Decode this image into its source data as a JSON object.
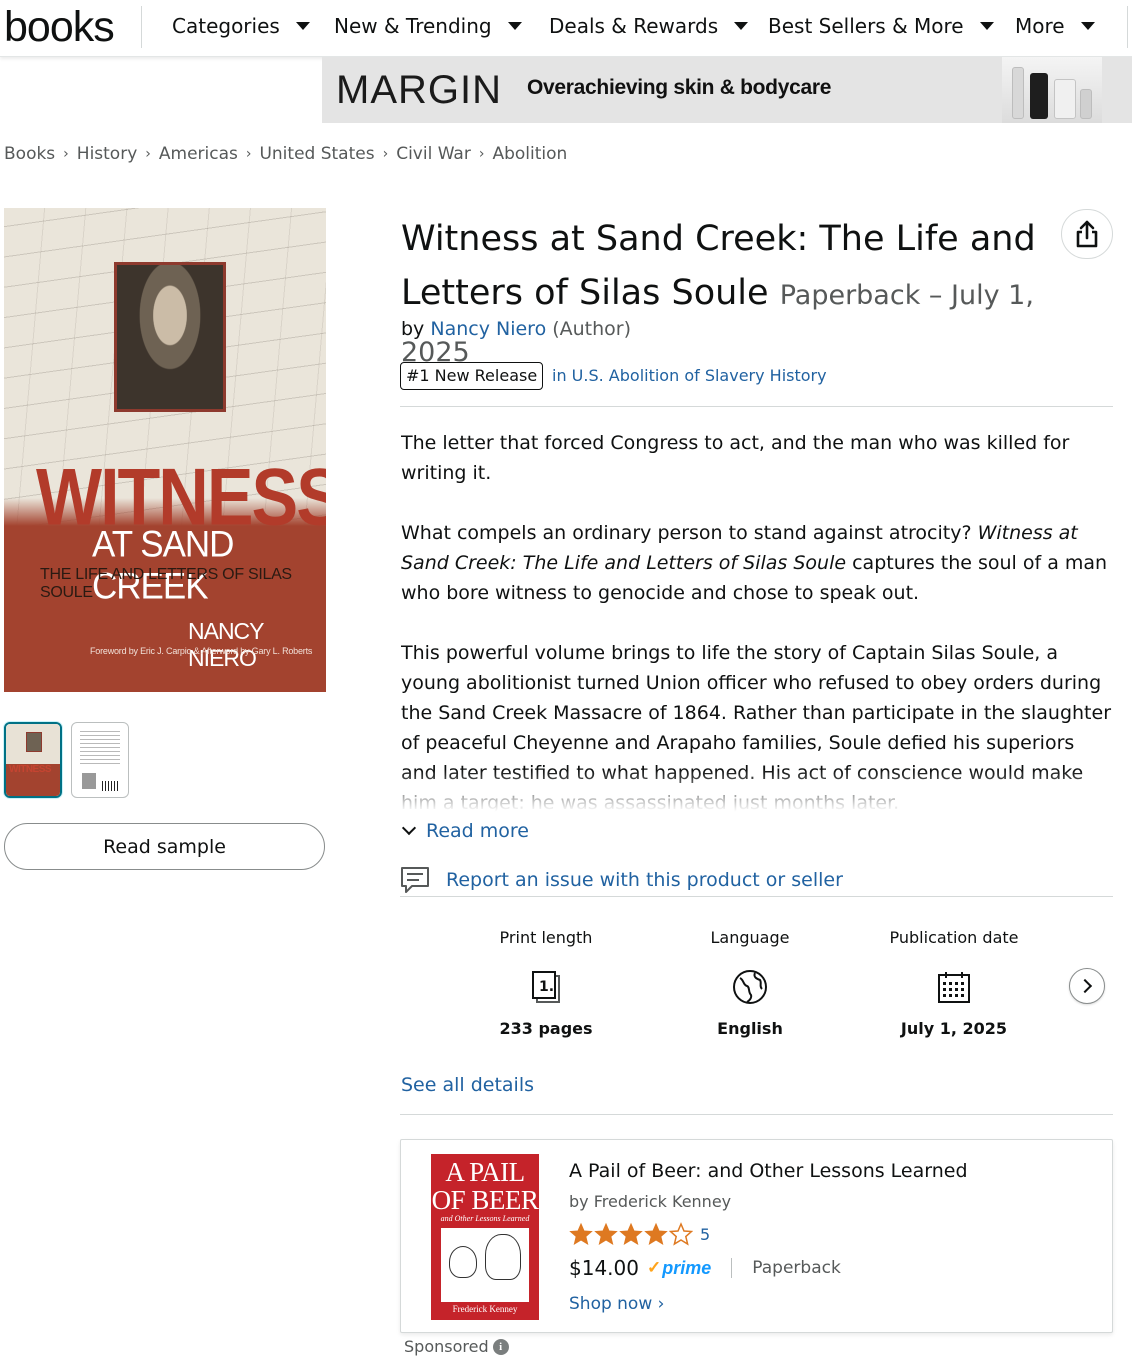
{
  "nav": {
    "logo": "books",
    "items": [
      "Categories",
      "New & Trending",
      "Deals & Rewards",
      "Best Sellers & More",
      "More"
    ]
  },
  "banner": {
    "brand": "MARGIN",
    "tagline": "Overachieving skin & bodycare"
  },
  "breadcrumb": [
    "Books",
    "History",
    "Americas",
    "United States",
    "Civil War",
    "Abolition"
  ],
  "cover": {
    "title": "WITNESS",
    "subtitle": "AT SAND CREEK",
    "subtitle2": "THE LIFE AND LETTERS OF SILAS SOULE",
    "author": "NANCY NIERO",
    "foreword": "Foreword by Eric J. Carpio & Afterword by Gary L. Roberts",
    "thumb_text": "WITNESS"
  },
  "read_sample": "Read sample",
  "product": {
    "title": "Witness at Sand Creek: The Life and Letters of Silas Soule",
    "format": "Paperback – July 1, 2025",
    "by": "by",
    "author": "Nancy Niero",
    "role": "(Author)",
    "badge": "#1 New Release",
    "badge_category": "in U.S. Abolition of Slavery History"
  },
  "description": {
    "p1": "The letter that forced Congress to act, and the man who was killed for writing it.",
    "p2_pre": "What compels an ordinary person to stand against atrocity? ",
    "p2_italic": "Witness at Sand Creek: The Life and Letters of Silas Soule",
    "p2_post": " captures the soul of a man who bore witness to genocide and chose to speak out.",
    "p3": "This powerful volume brings to life the story of Captain Silas Soule, a young abolitionist turned Union officer who refused to obey orders during the Sand Creek Massacre of 1864. Rather than participate in the slaughter of peaceful Cheyenne and Arapaho families, Soule defied his superiors and later testified to what happened. His act of conscience would make him a target: he was assassinated just months later.",
    "read_more": "Read more"
  },
  "report_link": "Report an issue with this product or seller",
  "details": [
    {
      "label": "Print length",
      "icon": "pages-icon",
      "value": "233 pages"
    },
    {
      "label": "Language",
      "icon": "globe-icon",
      "value": "English"
    },
    {
      "label": "Publication date",
      "icon": "calendar-icon",
      "value": "July 1, 2025"
    }
  ],
  "see_all_details": "See all details",
  "sponsored_product": {
    "cover_title": "A PAIL OF BEER",
    "cover_subtitle": "and Other Lessons Learned",
    "cover_author": "Frederick Kenney",
    "title": "A Pail of Beer: and Other Lessons Learned",
    "author": "by Frederick Kenney",
    "rating": 4.5,
    "rating_count": "5",
    "price": "$14.00",
    "prime": "prime",
    "format": "Paperback",
    "shop_now": "Shop now ›"
  },
  "sponsored_label": "Sponsored",
  "colors": {
    "link": "#2162a1",
    "text": "#0f1111",
    "muted": "#565959",
    "star": "#de7921",
    "prime": "#1399ff",
    "cover_red": "#a3432f"
  }
}
